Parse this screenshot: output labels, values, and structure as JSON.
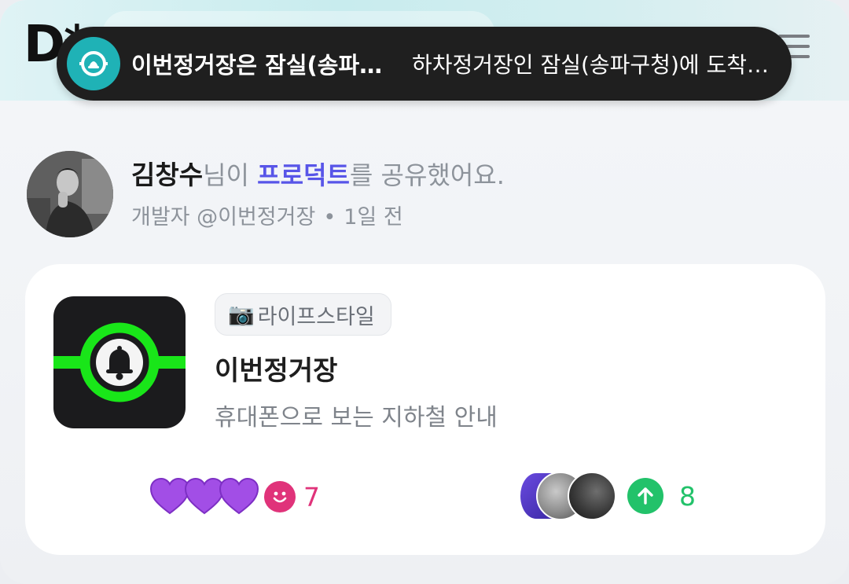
{
  "header": {
    "logo_text": "D*",
    "menu_icon": "hamburger-menu-icon"
  },
  "notification": {
    "icon": "stop-alert-icon",
    "title": "이번정거장은 잠실(송파구…",
    "body": "하차정거장인 잠실(송파구청)에 도착…",
    "colors": {
      "background": "#1f1f1f",
      "icon_bg": "#1fb2b6"
    }
  },
  "post": {
    "author_name": "김창수",
    "text_mid": "님이 ",
    "link_text": "프로덕트",
    "text_end": "를 공유했어요.",
    "role": "개발자 @이번정거장",
    "dot": "•",
    "time": "1일 전"
  },
  "product": {
    "category_icon": "📷",
    "category": "라이프스타일",
    "name": "이번정거장",
    "description": "휴대폰으로 보는 지하철 안내",
    "app_icon": "bell-station-icon",
    "colors": {
      "icon_bg": "#1b1b1d",
      "accent": "#19e619"
    }
  },
  "reactions": {
    "icons": [
      "purple-heart-icon",
      "purple-heart-icon",
      "purple-heart-icon",
      "smile-icon"
    ],
    "count": "7",
    "color": "#e0337a"
  },
  "upvotes": {
    "count": "8",
    "color": "#22c26a",
    "icon": "arrow-up-icon"
  }
}
